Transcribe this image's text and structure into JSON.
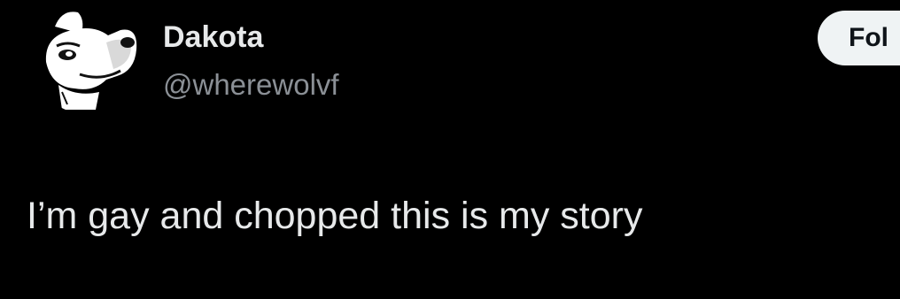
{
  "author": {
    "display_name": "Dakota",
    "handle": "@wherewolvf",
    "avatar_icon": "cartoon-dog-avatar"
  },
  "actions": {
    "follow_label": "Fol"
  },
  "tweet": {
    "text": "I’m gay and chopped this is my story"
  },
  "colors": {
    "background": "#000000",
    "primary_text": "#e7e9ea",
    "secondary_text": "#8b9096",
    "follow_button_bg": "#eff3f4",
    "follow_button_text": "#0f1419"
  }
}
